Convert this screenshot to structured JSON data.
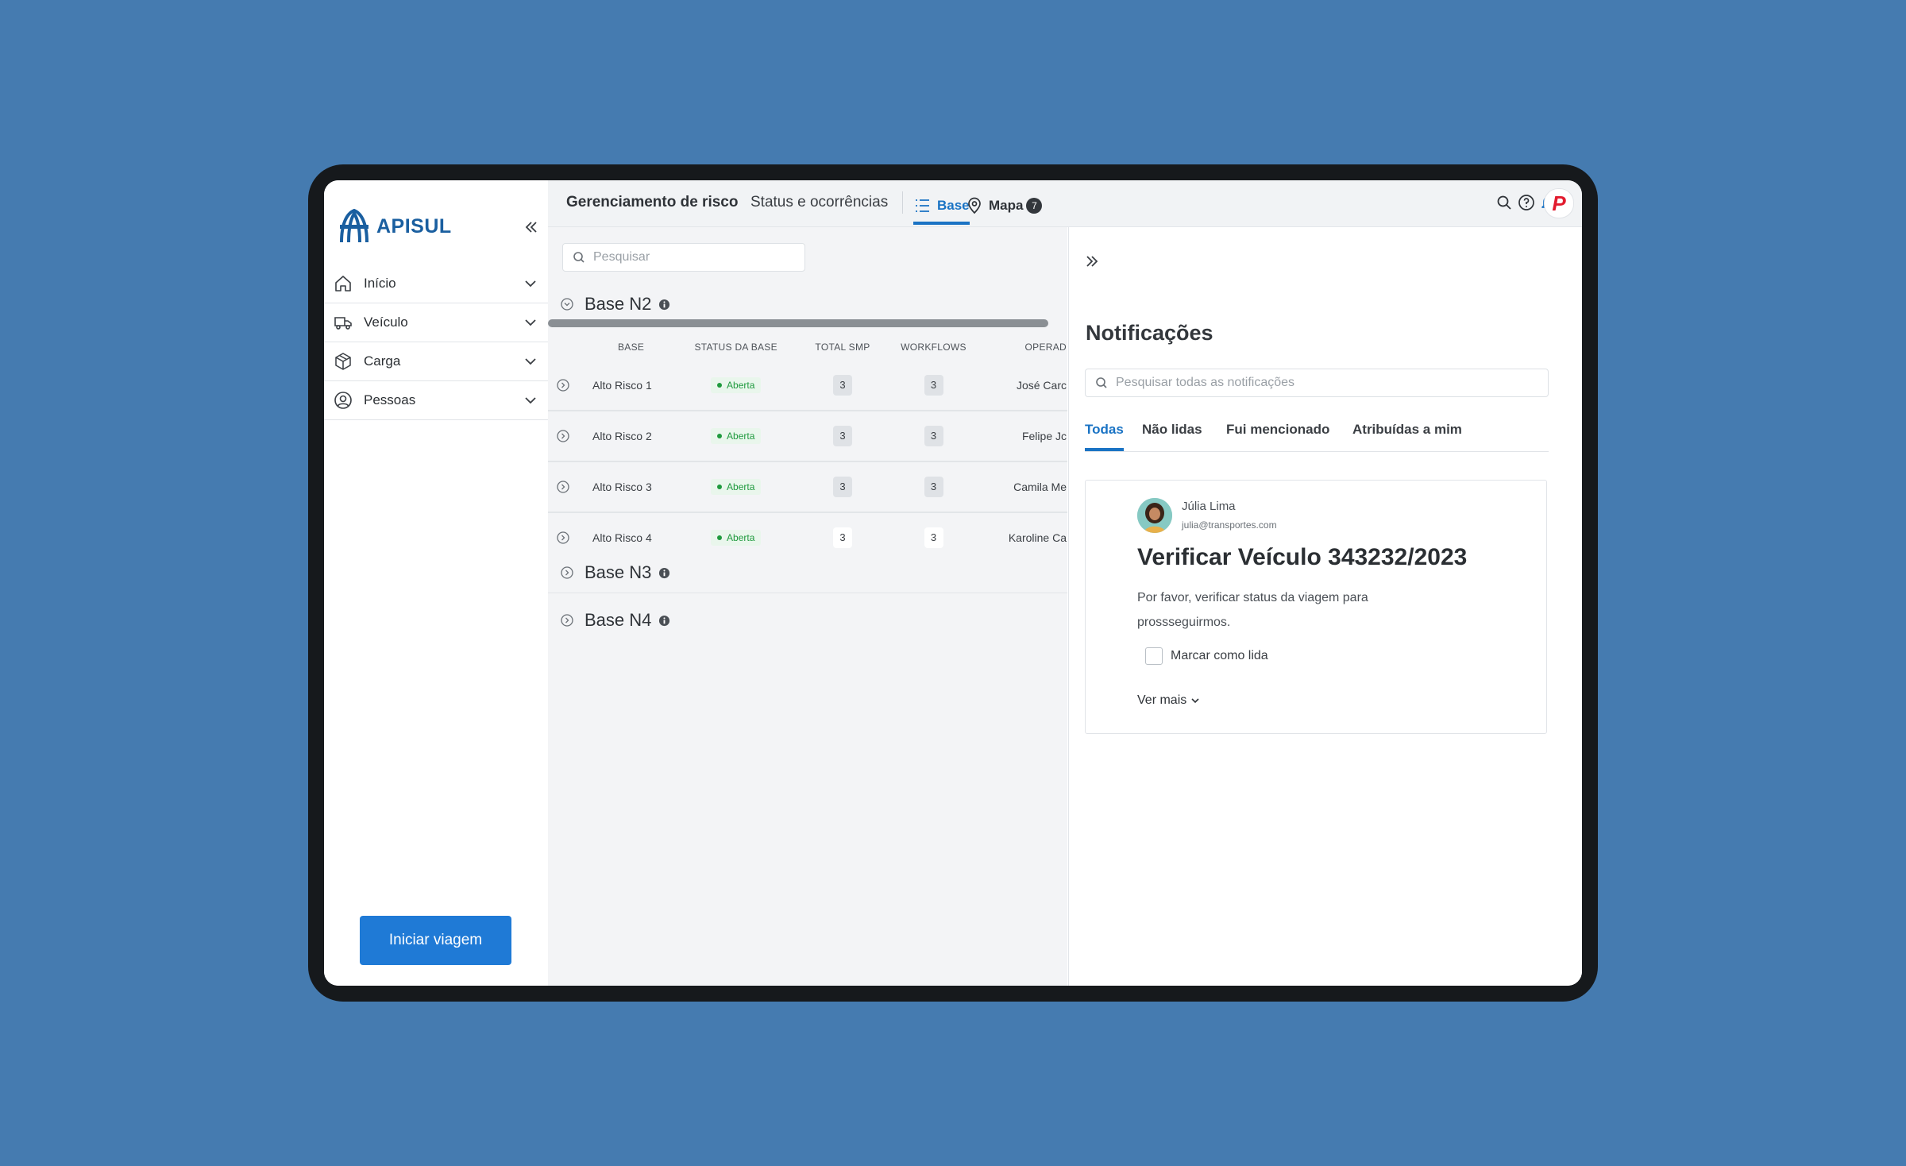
{
  "colors": {
    "background": "#457bb0",
    "accent": "#1a73c4",
    "primary_button": "#1f7ad6",
    "status_green": "#1f9a3e"
  },
  "sidebar": {
    "logo_text": "APISUL",
    "items": [
      {
        "label": "Início",
        "icon": "home-icon"
      },
      {
        "label": "Veículo",
        "icon": "truck-icon"
      },
      {
        "label": "Carga",
        "icon": "package-icon"
      },
      {
        "label": "Pessoas",
        "icon": "user-circle-icon"
      }
    ],
    "start_button": "Iniciar viagem"
  },
  "header": {
    "title": "Gerenciamento de risco",
    "subtitle": "Status e ocorrências",
    "tab_base": "Base",
    "tab_map": "Mapa",
    "map_badge": "7",
    "user_logo": "P"
  },
  "main": {
    "search_placeholder": "Pesquisar",
    "groups": [
      "Base N2",
      "Base N3",
      "Base N4"
    ],
    "columns": [
      "BASE",
      "STATUS DA BASE",
      "TOTAL SMP",
      "WORKFLOWS",
      "OPERAD"
    ],
    "rows": [
      {
        "base": "Alto Risco 1",
        "status": "Aberta",
        "total_smp": "3",
        "workflows": "3",
        "operator": "José Carc"
      },
      {
        "base": "Alto Risco 2",
        "status": "Aberta",
        "total_smp": "3",
        "workflows": "3",
        "operator": "Felipe Jc"
      },
      {
        "base": "Alto Risco 3",
        "status": "Aberta",
        "total_smp": "3",
        "workflows": "3",
        "operator": "Camila Me"
      },
      {
        "base": "Alto Risco 4",
        "status": "Aberta",
        "total_smp": "3",
        "workflows": "3",
        "operator": "Karoline Ca"
      }
    ]
  },
  "notifications": {
    "title": "Notificações",
    "search_placeholder": "Pesquisar todas as notificações",
    "tabs": [
      "Todas",
      "Não lidas",
      "Fui mencionado",
      "Atribuídas a mim"
    ],
    "card": {
      "sender_name": "Júlia Lima",
      "sender_email": "julia@transportes.com",
      "title": "Verificar Veículo 343232/2023",
      "body": "Por favor, verificar status da viagem para prossseguirmos.",
      "mark_read_label": "Marcar como lida",
      "see_more": "Ver mais"
    }
  }
}
